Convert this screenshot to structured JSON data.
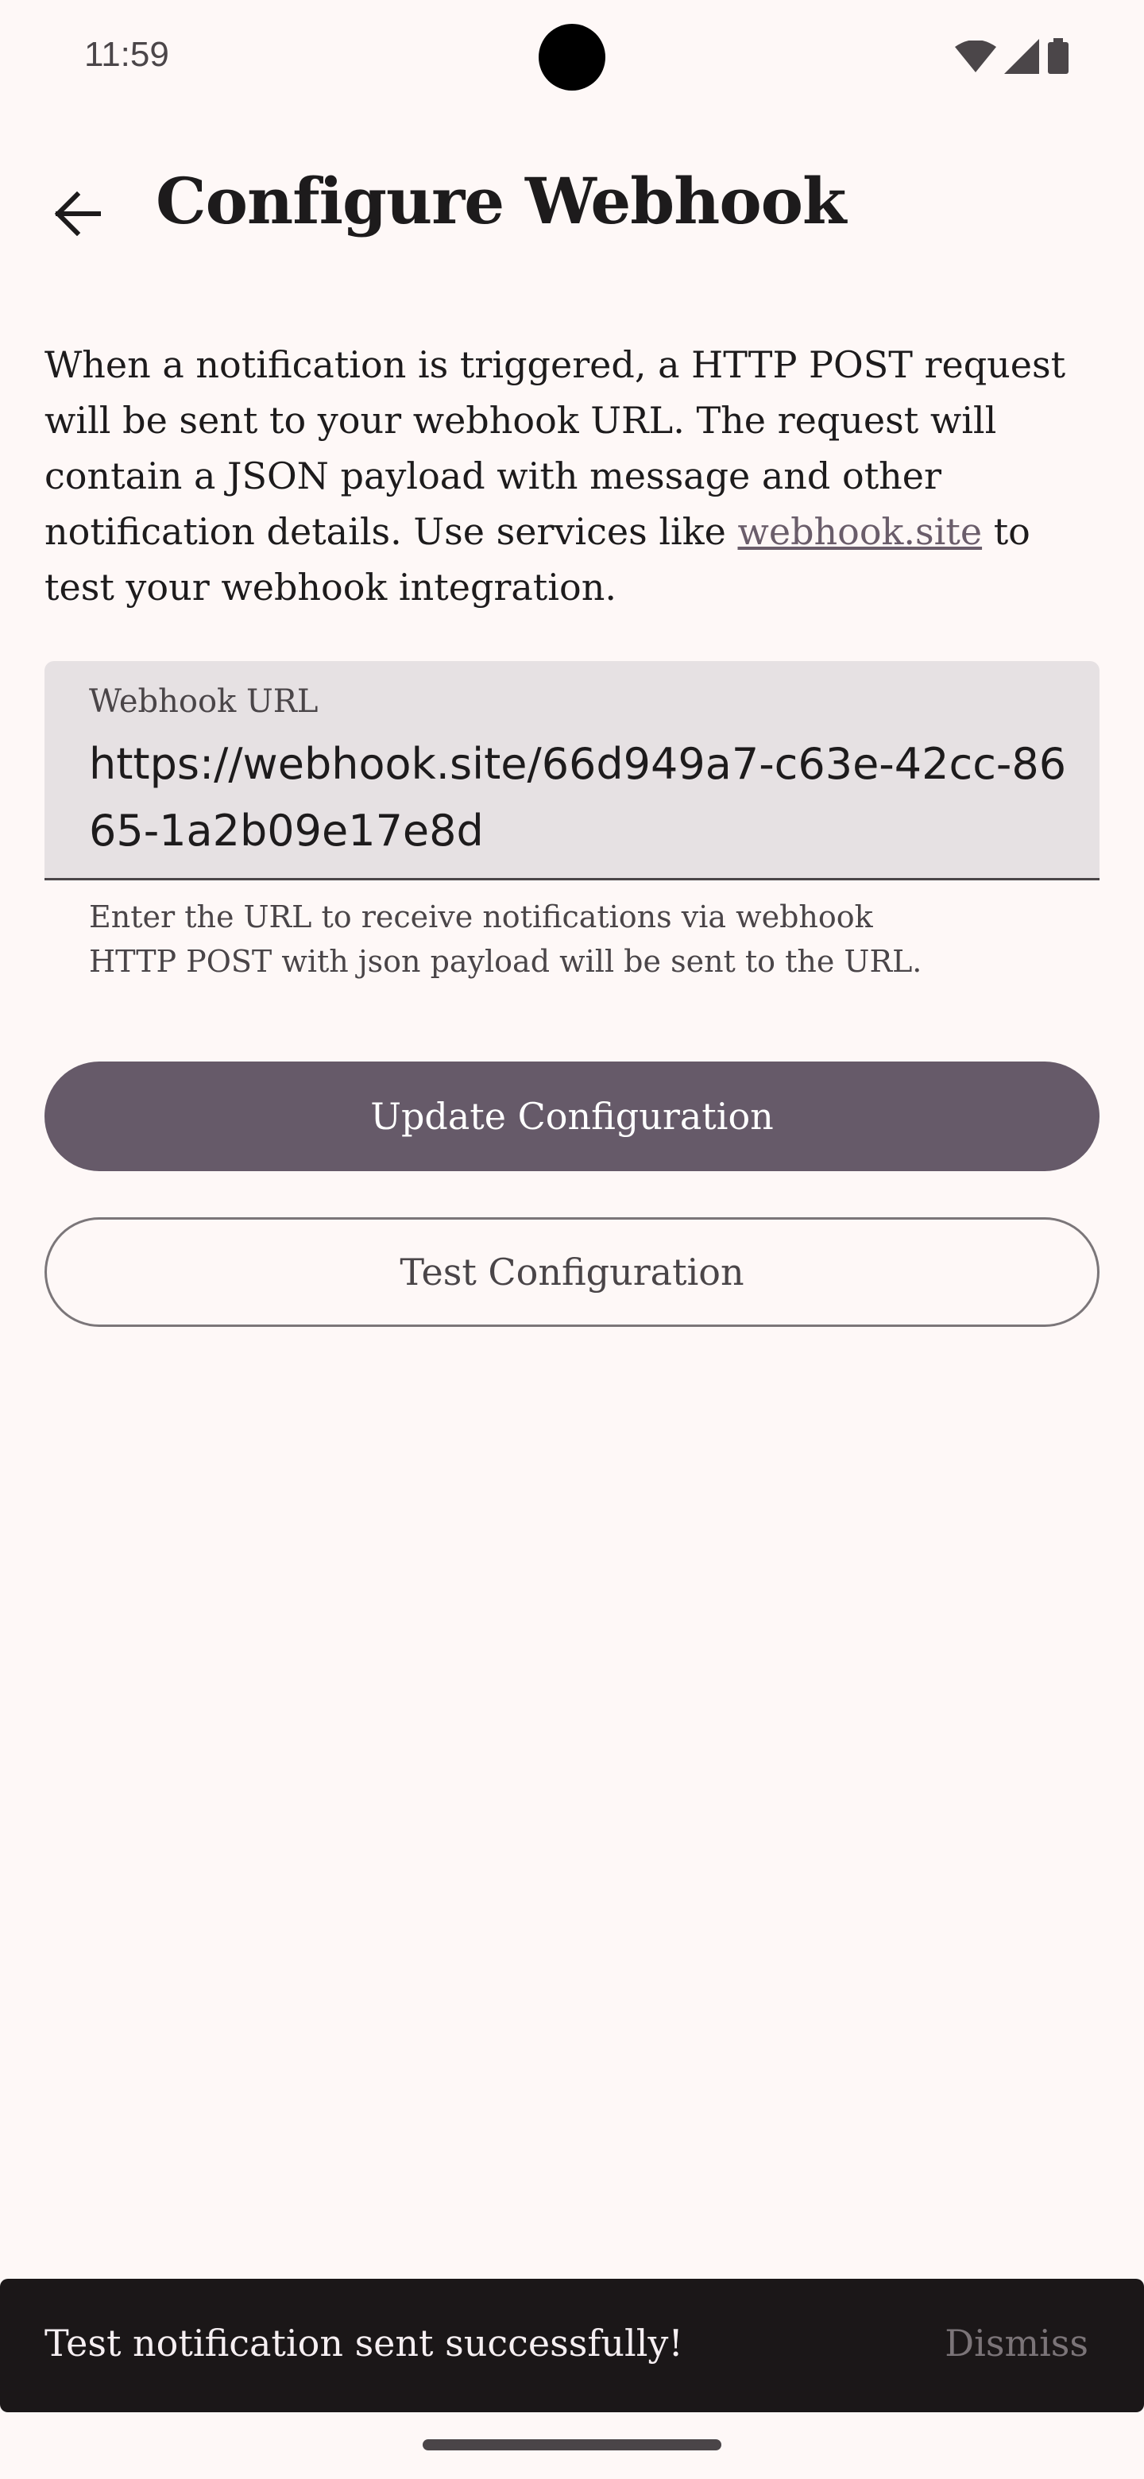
{
  "status_bar": {
    "time": "11:59",
    "icons": [
      "wifi-icon",
      "cellular-signal-icon",
      "battery-icon"
    ]
  },
  "app_bar": {
    "back_icon": "arrow-back-icon",
    "title": "Configure Webhook"
  },
  "description": {
    "text_before_link": "When a notification is triggered, a HTTP POST request will be sent to your webhook URL. The request will contain a JSON payload with message and other notification details. Use services like ",
    "link_text": "webhook.site",
    "text_after_link": " to test your webhook integration."
  },
  "webhook_field": {
    "label": "Webhook URL",
    "value": "https://webhook.site/66d949a7-c63e-42cc-8665-1a2b09e17e8d",
    "supporting_text_line1": "Enter the URL to receive notifications via webhook",
    "supporting_text_line2": "HTTP POST with json payload will be sent to the URL."
  },
  "actions": {
    "update_label": "Update Configuration",
    "test_label": "Test Configuration"
  },
  "snackbar": {
    "message": "Test notification sent successfully!",
    "action_label": "Dismiss"
  },
  "colors": {
    "background": "#fef8f7",
    "primary": "#665a69",
    "field_background": "#e6e1e3",
    "snackbar_background": "#1b1718"
  }
}
